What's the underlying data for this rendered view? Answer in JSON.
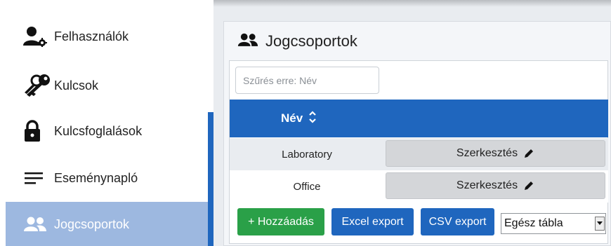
{
  "sidebar": {
    "items": [
      {
        "label": "Felhasználók",
        "icon": "user-gear-icon"
      },
      {
        "label": "Kulcsok",
        "icon": "keys-icon"
      },
      {
        "label": "Kulcsfoglalások",
        "icon": "lock-icon"
      },
      {
        "label": "Eseménynapló",
        "icon": "list-lines-icon"
      },
      {
        "label": "Jogcsoportok",
        "icon": "group-icon",
        "active": true
      }
    ]
  },
  "main": {
    "title": "Jogcsoportok",
    "filter_placeholder": "Szűrés erre: Név",
    "table": {
      "column_name": "Név",
      "rows": [
        {
          "name": "Laboratory",
          "action": "Szerkesztés"
        },
        {
          "name": "Office",
          "action": "Szerkesztés"
        }
      ]
    },
    "buttons": {
      "add": "+ Hozzáadás",
      "excel": "Excel export",
      "csv": "CSV export"
    },
    "export_scope": "Egész tábla"
  },
  "colors": {
    "primary": "#1f66be",
    "success": "#2aa048",
    "active_sidebar": "#9db8e0"
  }
}
